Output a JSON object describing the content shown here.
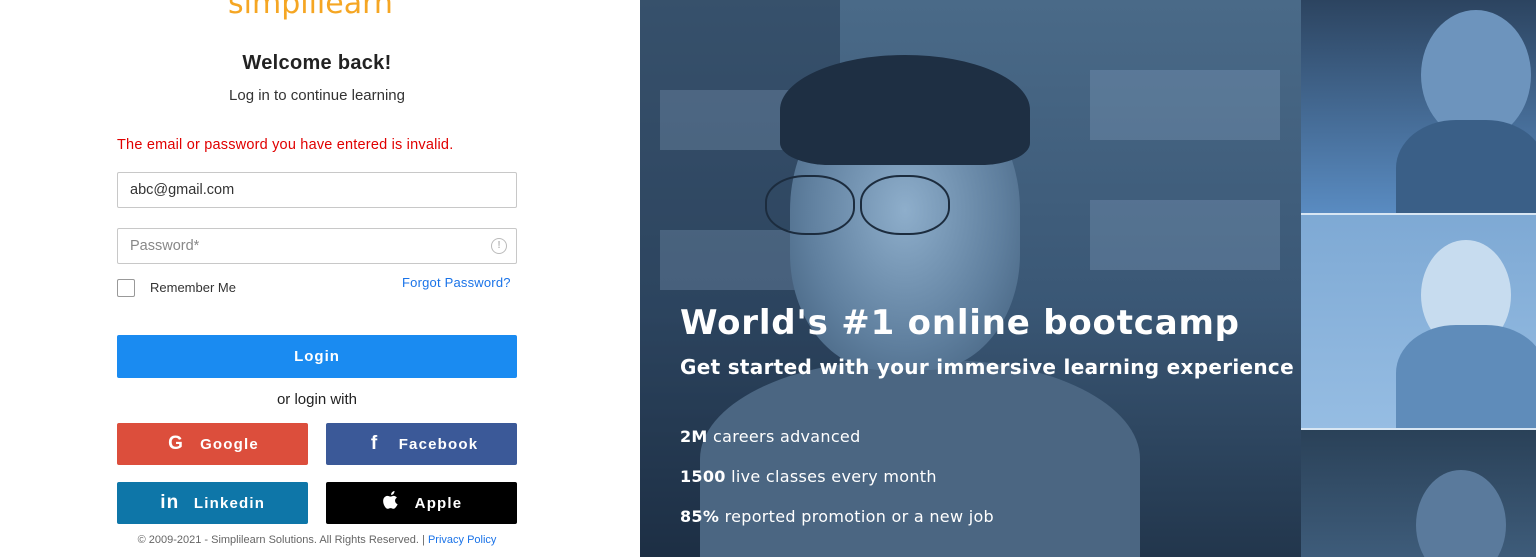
{
  "brand": {
    "logo_text": "simplilearn"
  },
  "login": {
    "title": "Welcome back!",
    "subtitle": "Log in to continue learning",
    "error_message": "The email or password you have entered is invalid.",
    "email_value": "abc@gmail.com",
    "password_placeholder": "Password*",
    "remember_label": "Remember Me",
    "forgot_label": "Forgot Password?",
    "login_button": "Login",
    "or_text": "or login with",
    "social": {
      "google": "Google",
      "facebook": "Facebook",
      "linkedin": "Linkedin",
      "apple": "Apple"
    },
    "footer_text": "© 2009-2021 - Simplilearn Solutions. All Rights Reserved. | ",
    "privacy_label": "Privacy Policy"
  },
  "promo": {
    "headline": "World's #1 online bootcamp",
    "subheadline": "Get started with your immersive learning experience",
    "stats": [
      {
        "value": "2M",
        "label": "careers advanced"
      },
      {
        "value": "1500",
        "label": "live classes every month"
      },
      {
        "value": "85%",
        "label": "reported promotion or a new job"
      }
    ]
  },
  "colors": {
    "error": "#e00000",
    "primary_button": "#1a8bf1",
    "google": "#dc4e3c",
    "facebook": "#3b5998",
    "linkedin": "#0e76a8",
    "apple": "#000000",
    "link": "#1a73e8",
    "logo": "#f5a623"
  },
  "icons": {
    "password_warning": "exclamation-circle-icon",
    "google": "google-g-icon",
    "facebook": "facebook-f-icon",
    "linkedin": "linkedin-in-icon",
    "apple": "apple-logo-icon"
  }
}
